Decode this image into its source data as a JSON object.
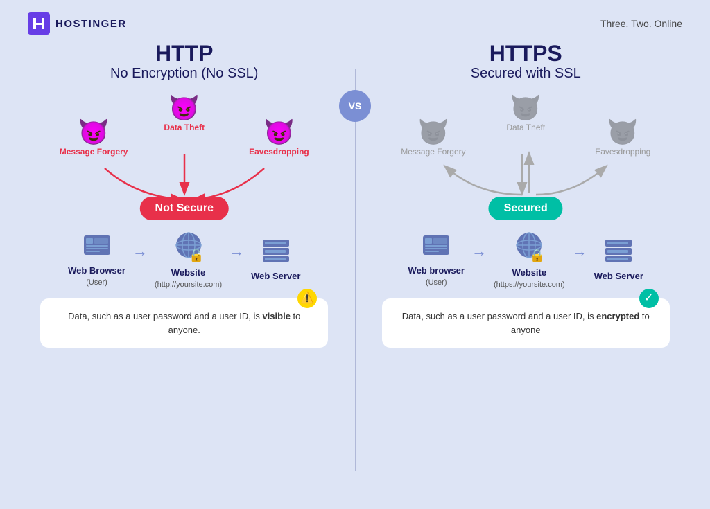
{
  "header": {
    "logo_text": "HOSTINGER",
    "tagline": "Three. Two. Online"
  },
  "vs_label": "VS",
  "http": {
    "title": "HTTP",
    "subtitle": "No Encryption (No SSL)",
    "threats": {
      "left": {
        "label": "Message Forgery",
        "color": "red"
      },
      "center": {
        "label": "Data Theft",
        "color": "red"
      },
      "right": {
        "label": "Eavesdropping",
        "color": "red"
      }
    },
    "badge": "Not Secure",
    "browser": {
      "name": "Web Browser",
      "sub": "(User)"
    },
    "website": {
      "name": "Website",
      "sub": "(http://yoursite.com)"
    },
    "server": {
      "name": "Web Server",
      "sub": ""
    },
    "info": "Data, such as a user password and a user ID, is ",
    "info_bold": "visible",
    "info_end": " to anyone.",
    "info_icon": "warning"
  },
  "https": {
    "title": "HTTPS",
    "subtitle": "Secured with SSL",
    "threats": {
      "left": {
        "label": "Message Forgery",
        "color": "gray"
      },
      "center": {
        "label": "Data Theft",
        "color": "gray"
      },
      "right": {
        "label": "Eavesdropping",
        "color": "gray"
      }
    },
    "badge": "Secured",
    "browser": {
      "name": "Web browser",
      "sub": "(User)"
    },
    "website": {
      "name": "Website",
      "sub": "(https://yoursite.com)"
    },
    "server": {
      "name": "Web Server",
      "sub": ""
    },
    "info": "Data, such as a user password and a user ID, is ",
    "info_bold": "encrypted",
    "info_end": " to anyone",
    "info_icon": "success"
  }
}
